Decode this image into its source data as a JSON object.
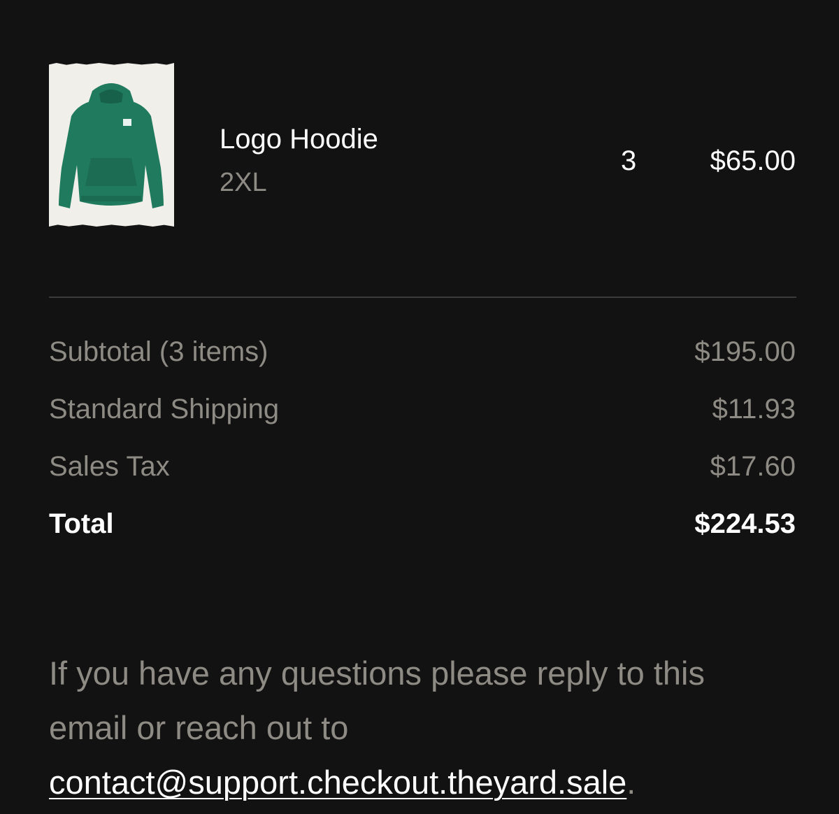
{
  "order_item": {
    "image_alt": "Green logo hoodie",
    "name": "Logo Hoodie",
    "variant": "2XL",
    "quantity": "3",
    "price": "$65.00",
    "colors": {
      "hoodie": "#1f7a5e",
      "hoodie_shadow": "#17614a",
      "background": "#f1efea"
    }
  },
  "summary": {
    "rows": [
      {
        "label": "Subtotal (3 items)",
        "value": "$195.00"
      },
      {
        "label": "Standard Shipping",
        "value": "$11.93"
      },
      {
        "label": "Sales Tax",
        "value": "$17.60"
      }
    ],
    "total": {
      "label": "Total",
      "value": "$224.53"
    }
  },
  "footer": {
    "text_before": "If you have any questions please reply to this email or reach out to ",
    "email_link": "contact@support.checkout.theyard.sale",
    "text_after": "."
  },
  "theme": {
    "background": "#121212",
    "primary_text": "#ffffff",
    "muted_text": "#8e8b84",
    "divider": "#3a3a3a"
  }
}
